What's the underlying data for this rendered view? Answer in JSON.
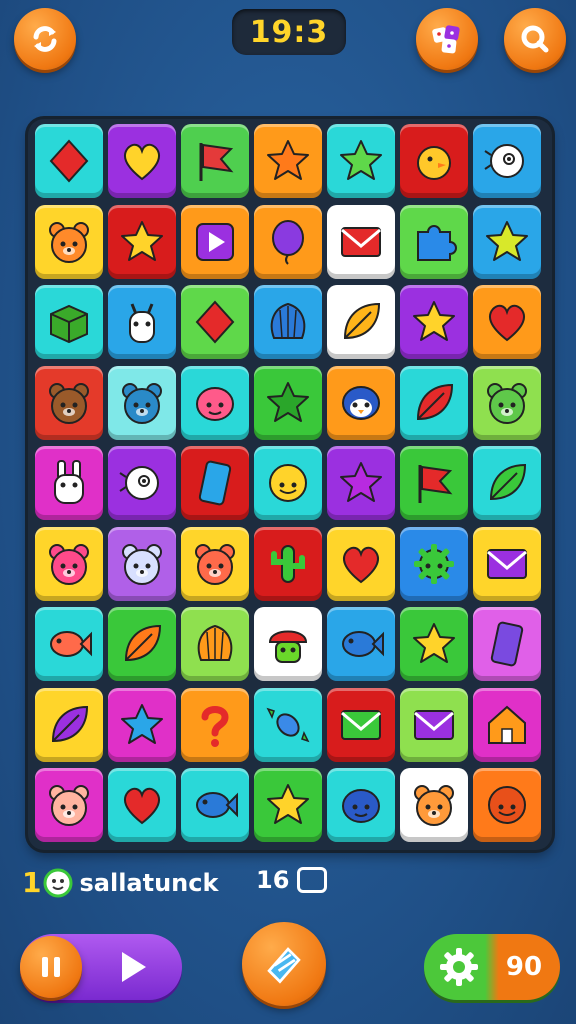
{
  "header": {
    "timer": "19:3",
    "refresh_icon": "refresh-icon",
    "inventory_icon": "dice-icon",
    "search_icon": "search-icon"
  },
  "colors": {
    "background": "#23578f",
    "accent": "#f07812",
    "timer_text": "#ffd52a"
  },
  "board": {
    "rows": [
      [
        [
          "#2ad8d8",
          "diamond-icon",
          "#e42a2a"
        ],
        [
          "#9b30e0",
          "heart-icon",
          "#ffd32a"
        ],
        [
          "#4fcf4f",
          "flag-icon",
          "#e43a3a"
        ],
        [
          "#ff9a1a",
          "star-icon",
          "#ff7a1a"
        ],
        [
          "#2ad8d8",
          "star-icon",
          "#5fd84a"
        ],
        [
          "#d81c1c",
          "chick-icon",
          "#ffc82a"
        ],
        [
          "#2aa6e8",
          "bird-icon",
          "#ffffff"
        ]
      ],
      [
        [
          "#ffd52a",
          "bear-icon",
          "#ff8a2a"
        ],
        [
          "#d81c1c",
          "star-icon",
          "#ffd32a"
        ],
        [
          "#ff9a1a",
          "play-icon",
          "#9b30e0"
        ],
        [
          "#ff9a1a",
          "balloon-icon",
          "#8a3ae0"
        ],
        [
          "#ffffff",
          "envelope-icon",
          "#e42a2a"
        ],
        [
          "#5fd84a",
          "puzzle-icon",
          "#2a8ae8"
        ],
        [
          "#2aa6e8",
          "star-icon",
          "#d8e82a"
        ]
      ],
      [
        [
          "#2ad8d8",
          "box-icon",
          "#3aaa2a"
        ],
        [
          "#2aa6e8",
          "goat-icon",
          "#ffffff"
        ],
        [
          "#5fd84a",
          "diamond-icon",
          "#e42a2a"
        ],
        [
          "#2aa6e8",
          "shell-icon",
          "#2a7ad8"
        ],
        [
          "#ffffff",
          "leaf-icon",
          "#ffb41a"
        ],
        [
          "#9b30e0",
          "star-icon",
          "#ffd32a"
        ],
        [
          "#ff9a1a",
          "heart-icon",
          "#e42a2a"
        ]
      ],
      [
        [
          "#e43a2a",
          "bear-icon",
          "#9a5a2a"
        ],
        [
          "#7fe8e8",
          "bear-icon",
          "#2a8ac8"
        ],
        [
          "#2ad8d8",
          "blob-icon",
          "#ff5a8a"
        ],
        [
          "#3ac83a",
          "star-icon",
          "#2aa62a"
        ],
        [
          "#ff9a1a",
          "penguin-icon",
          "#2a5ac8"
        ],
        [
          "#2ad8d8",
          "leaf-icon",
          "#e42a2a"
        ],
        [
          "#8fe04f",
          "bear-icon",
          "#5fc84a"
        ]
      ],
      [
        [
          "#e030c8",
          "rabbit-icon",
          "#ffffff"
        ],
        [
          "#9b30e0",
          "bird-icon",
          "#ffffff"
        ],
        [
          "#d81c1c",
          "card-icon",
          "#2aa6e8"
        ],
        [
          "#2ad8d8",
          "smiley-icon",
          "#ffd32a"
        ],
        [
          "#9b30e0",
          "star-icon",
          "#b82ae0"
        ],
        [
          "#3ac83a",
          "flag-icon",
          "#e42a2a"
        ],
        [
          "#2ad8d8",
          "leaf-icon",
          "#3ac83a"
        ]
      ],
      [
        [
          "#ffd52a",
          "bear-icon",
          "#ff4a8a"
        ],
        [
          "#b060e8",
          "bear-icon",
          "#d8e0ff"
        ],
        [
          "#ffd52a",
          "bear-icon",
          "#ff6a4a"
        ],
        [
          "#d81c1c",
          "cactus-icon",
          "#3ac83a"
        ],
        [
          "#ffd52a",
          "heart-icon",
          "#e42a2a"
        ],
        [
          "#2a8ae8",
          "gear-icon",
          "#3ac83a"
        ],
        [
          "#ffd52a",
          "envelope-icon",
          "#9b30e0"
        ]
      ],
      [
        [
          "#2ad8d8",
          "fish-icon",
          "#ff6a4a"
        ],
        [
          "#3ac83a",
          "leaf-icon",
          "#ff7a1a"
        ],
        [
          "#8fe04f",
          "shell-icon",
          "#ff9a1a"
        ],
        [
          "#ffffff",
          "mushroom-icon",
          "#6ad82a"
        ],
        [
          "#2aa6e8",
          "fish-icon",
          "#2a7ad8"
        ],
        [
          "#3ac83a",
          "star-icon",
          "#ffd32a"
        ],
        [
          "#e060e8",
          "card-icon",
          "#7a4ae0"
        ]
      ],
      [
        [
          "#ffd52a",
          "leaf-icon",
          "#9b30e0"
        ],
        [
          "#e030c8",
          "star-icon",
          "#2aa6e8"
        ],
        [
          "#ff9a1a",
          "question-icon",
          "#e42a2a"
        ],
        [
          "#2ad8d8",
          "candy-icon",
          "#3a8ae8"
        ],
        [
          "#d81c1c",
          "envelope-icon",
          "#3ac83a"
        ],
        [
          "#8fe04f",
          "envelope-icon",
          "#9b30e0"
        ],
        [
          "#e030c8",
          "house-icon",
          "#ff9a1a"
        ]
      ],
      [
        [
          "#e030c8",
          "bear-icon",
          "#ffb4a0"
        ],
        [
          "#2ad8d8",
          "heart-icon",
          "#e42a2a"
        ],
        [
          "#2ad8d8",
          "fish-icon",
          "#2a7ad8"
        ],
        [
          "#3ac83a",
          "star-icon",
          "#ffd32a"
        ],
        [
          "#2ad8d8",
          "blob-icon",
          "#2a5ac8"
        ],
        [
          "#ffffff",
          "bear-icon",
          "#ff9a3a"
        ],
        [
          "#ff7a1a",
          "smiley-icon",
          "#e8501a"
        ]
      ]
    ]
  },
  "status": {
    "count": "1",
    "face_icon": "smiley-icon",
    "player_name": "sallatunck",
    "score": "16",
    "card_icon": "card-outline-icon"
  },
  "controls": {
    "pause_icon": "pause-icon",
    "play_icon": "play-icon",
    "powerup_icon": "shuffle-icon",
    "settings_icon": "gear-icon",
    "moves": "90"
  }
}
